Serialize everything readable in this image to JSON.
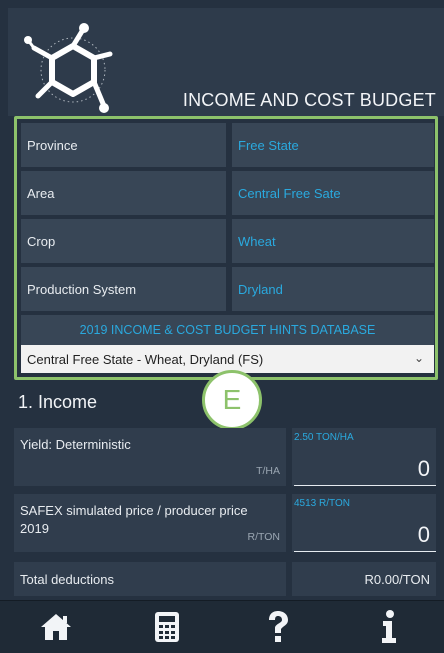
{
  "header": {
    "title": "INCOME AND COST BUDGET",
    "logo_icon": "molecule-logo-icon"
  },
  "selection": {
    "rows": [
      {
        "label": "Province",
        "value": "Free State"
      },
      {
        "label": "Area",
        "value": "Central Free Sate"
      },
      {
        "label": "Crop",
        "value": "Wheat"
      },
      {
        "label": "Production System",
        "value": "Dryland"
      }
    ],
    "hints_label": "2019 INCOME & COST BUDGET HINTS DATABASE",
    "dropdown_value": "Central Free State - Wheat, Dryland (FS)",
    "border_color": "#8dc26b"
  },
  "step_marker": {
    "letter": "E"
  },
  "income": {
    "section_title": "1. Income",
    "rows": [
      {
        "label": "Yield: Deterministic",
        "unit": "T/HA",
        "hint": "2.50 TON/HA",
        "value": "0"
      },
      {
        "label": "SAFEX simulated price / producer price 2019",
        "unit": "R/TON",
        "hint": "4513 R/TON",
        "value": "0"
      }
    ],
    "deductions_label": "Total deductions",
    "deductions_value": "R0.00/TON"
  },
  "nav": {
    "items": [
      {
        "icon": "home-icon"
      },
      {
        "icon": "calculator-icon"
      },
      {
        "icon": "help-icon"
      },
      {
        "icon": "info-icon"
      }
    ]
  },
  "colors": {
    "accent_blue": "#2aa9de",
    "accent_green": "#8dc26b",
    "background": "#253140"
  }
}
